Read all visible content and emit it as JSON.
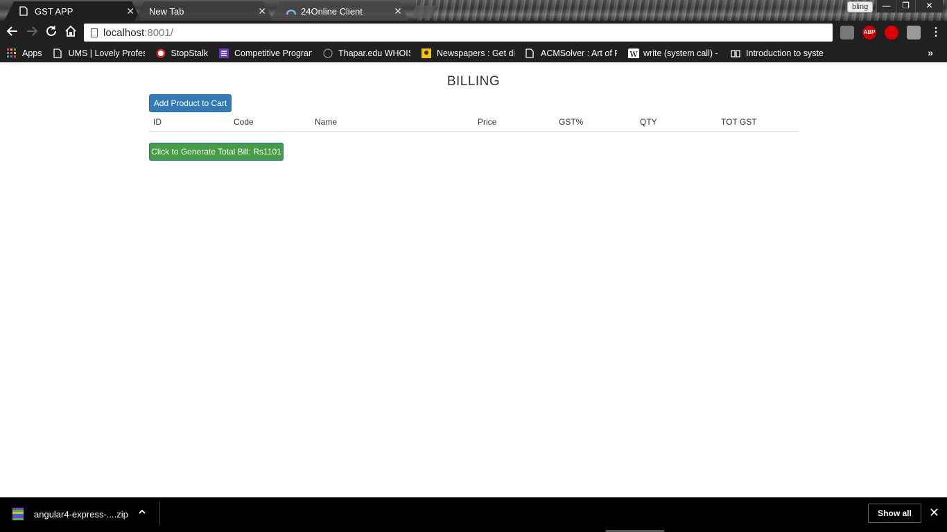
{
  "browser": {
    "tabs": [
      {
        "title": "GST APP",
        "icon": "page-icon",
        "active": true
      },
      {
        "title": "New Tab",
        "icon": "",
        "active": false
      },
      {
        "title": "24Online Client",
        "icon": "network-icon",
        "active": false
      }
    ],
    "profile_name": "bling",
    "window_controls": {
      "minimize": "—",
      "restore": "❐",
      "close": "✕"
    },
    "url_host": "localhost",
    "url_rest": ":8001/",
    "bookmarks": [
      {
        "label": "Apps",
        "icon": "apps-grid-icon"
      },
      {
        "label": "UMS | Lovely Profess",
        "icon": "page-icon"
      },
      {
        "label": "StopStalk",
        "icon": "stopstalk-icon"
      },
      {
        "label": "Competitive Progran",
        "icon": "list-icon"
      },
      {
        "label": "Thapar.edu WHOIS, I",
        "icon": "globe-icon"
      },
      {
        "label": "Newspapers : Get dig",
        "icon": "newspaper-icon"
      },
      {
        "label": "ACMSolver : Art of Pr",
        "icon": "page-icon"
      },
      {
        "label": "write (system call) - V",
        "icon": "wikipedia-icon"
      },
      {
        "label": "Introduction to syste",
        "icon": "book-icon"
      }
    ],
    "bookmarks_overflow": "»",
    "extensions": [
      "screenshot-ext-icon",
      "adblock-icon",
      "opera-icon",
      "ext-icon"
    ],
    "abp_label": "ABP"
  },
  "page": {
    "title": "BILLING",
    "add_button": "Add Product to Cart",
    "table_headers": [
      "ID",
      "Code",
      "Name",
      "Price",
      "GST%",
      "QTY",
      "TOT GST"
    ],
    "generate_button": "Click to Generate Total Bill: Rs1101"
  },
  "downloads": {
    "file_name": "angular4-express-....zip",
    "show_all": "Show all"
  },
  "colors": {
    "primary": "#337ab7",
    "success": "#449d44",
    "chrome_dark": "#202020"
  }
}
